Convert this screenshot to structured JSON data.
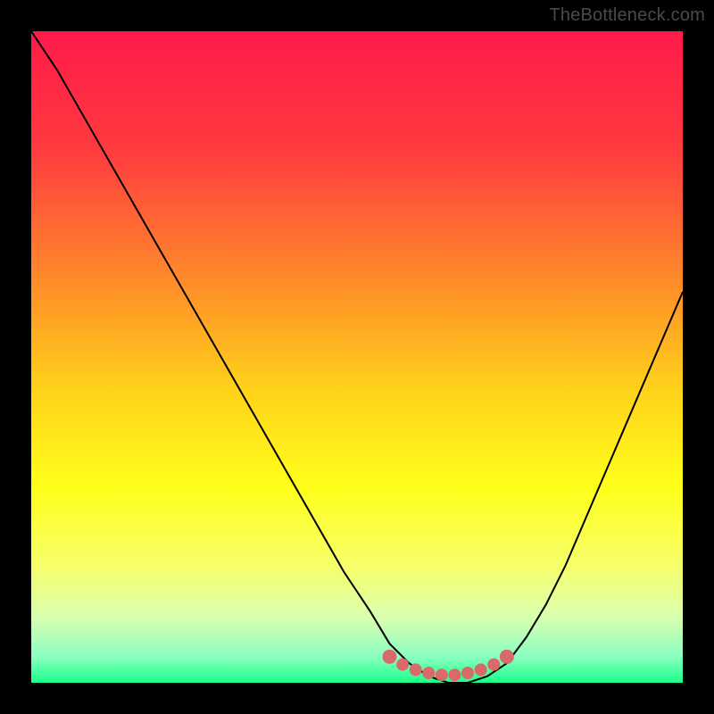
{
  "watermark": "TheBottleneck.com",
  "chart_data": {
    "type": "line",
    "title": "",
    "xlabel": "",
    "ylabel": "",
    "xlim": [
      0,
      100
    ],
    "ylim": [
      0,
      100
    ],
    "gradient_stops": [
      {
        "offset": 0,
        "color": "#ff1a4a"
      },
      {
        "offset": 18,
        "color": "#ff3a3f"
      },
      {
        "offset": 38,
        "color": "#ff8a2a"
      },
      {
        "offset": 55,
        "color": "#ffd21a"
      },
      {
        "offset": 70,
        "color": "#ffff1a"
      },
      {
        "offset": 82,
        "color": "#f6ff6a"
      },
      {
        "offset": 90,
        "color": "#d9ffb0"
      },
      {
        "offset": 96,
        "color": "#8affc0"
      },
      {
        "offset": 100,
        "color": "#1aff8a"
      }
    ],
    "series": [
      {
        "name": "bottleneck-curve",
        "color": "#000000",
        "x": [
          0,
          4,
          8,
          12,
          16,
          20,
          24,
          28,
          32,
          36,
          40,
          44,
          48,
          52,
          55,
          58,
          61,
          64,
          67,
          70,
          73,
          76,
          79,
          82,
          85,
          88,
          91,
          94,
          97,
          100
        ],
        "y": [
          100,
          94,
          87,
          80,
          73,
          66,
          59,
          52,
          45,
          38,
          31,
          24,
          17,
          11,
          6,
          3,
          1,
          0,
          0,
          1,
          3,
          7,
          12,
          18,
          25,
          32,
          39,
          46,
          53,
          60
        ]
      }
    ],
    "marker_band": {
      "name": "optimal-band",
      "color": "#d86a6a",
      "points": [
        {
          "x": 55,
          "y": 4.0
        },
        {
          "x": 57,
          "y": 2.8
        },
        {
          "x": 59,
          "y": 2.0
        },
        {
          "x": 61,
          "y": 1.5
        },
        {
          "x": 63,
          "y": 1.2
        },
        {
          "x": 65,
          "y": 1.2
        },
        {
          "x": 67,
          "y": 1.5
        },
        {
          "x": 69,
          "y": 2.0
        },
        {
          "x": 71,
          "y": 2.8
        },
        {
          "x": 73,
          "y": 4.0
        }
      ]
    }
  }
}
